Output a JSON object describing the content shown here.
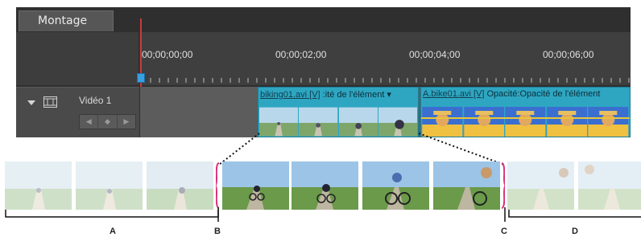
{
  "panel": {
    "tab_label": "Montage",
    "timecodes": [
      "00;00;00;00",
      "00;00;02;00",
      "00;00;04;00",
      "00;00;06;00"
    ]
  },
  "track": {
    "name": "Vidéo 1",
    "keyframe_prev": "◀",
    "keyframe_add": "◆",
    "keyframe_next": "▶"
  },
  "clips": [
    {
      "name": "biking01.avi [V]",
      "effect": ":ité de l'élément ▾"
    },
    {
      "name": "A.bike01.avi [V]",
      "effect": "Opacité:Opacité de l'élément"
    }
  ],
  "callouts": {
    "A": "A",
    "B": "B",
    "C": "C",
    "D": "D"
  },
  "colors": {
    "panel_bg": "#2f2f2f",
    "clip": "#2ea6c2",
    "playhead": "#c83a3a",
    "bracket": "#d9307a"
  }
}
